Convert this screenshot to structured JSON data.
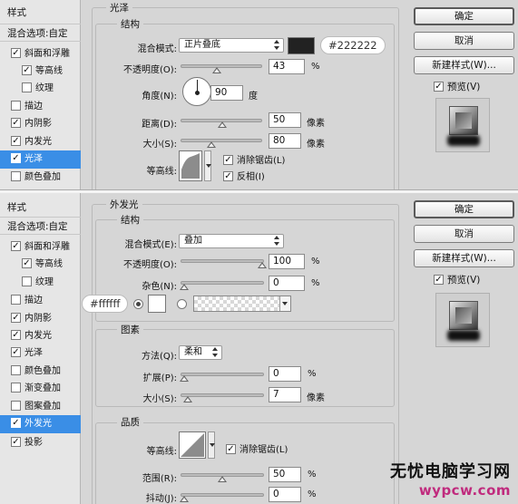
{
  "top": {
    "sidebar": {
      "header": "样式",
      "blend_options": "混合选项:自定",
      "items": [
        {
          "label": "斜面和浮雕",
          "checked": true
        },
        {
          "label": "等高线",
          "checked": true
        },
        {
          "label": "纹理",
          "checked": false
        },
        {
          "label": "描边",
          "checked": false
        },
        {
          "label": "内阴影",
          "checked": true
        },
        {
          "label": "内发光",
          "checked": true
        },
        {
          "label": "光泽",
          "checked": true
        },
        {
          "label": "颜色叠加",
          "checked": false
        }
      ]
    },
    "section_title": "光泽",
    "group_title": "结构",
    "blend_mode": {
      "label": "混合模式:",
      "value": "正片叠底"
    },
    "color_hex": "#222222",
    "color_value": "#222222",
    "opacity": {
      "label": "不透明度(O):",
      "value": "43",
      "unit": "%"
    },
    "angle": {
      "label": "角度(N):",
      "value": "90",
      "unit": "度"
    },
    "distance": {
      "label": "距离(D):",
      "value": "50",
      "unit": "像素"
    },
    "size": {
      "label": "大小(S):",
      "value": "80",
      "unit": "像素"
    },
    "contour": {
      "label": "等高线:"
    },
    "anti_alias": {
      "label": "消除锯齿(L)",
      "checked": true
    },
    "invert": {
      "label": "反相(I)",
      "checked": true
    },
    "buttons": {
      "ok": "确定",
      "cancel": "取消",
      "new_style": "新建样式(W)..."
    },
    "preview": {
      "label": "预览(V)",
      "checked": true
    }
  },
  "bottom": {
    "sidebar": {
      "header": "样式",
      "blend_options": "混合选项:自定",
      "items": [
        {
          "label": "斜面和浮雕",
          "checked": true
        },
        {
          "label": "等高线",
          "checked": true
        },
        {
          "label": "纹理",
          "checked": false
        },
        {
          "label": "描边",
          "checked": false
        },
        {
          "label": "内阴影",
          "checked": true
        },
        {
          "label": "内发光",
          "checked": true
        },
        {
          "label": "光泽",
          "checked": true
        },
        {
          "label": "颜色叠加",
          "checked": false
        },
        {
          "label": "渐变叠加",
          "checked": false
        },
        {
          "label": "图案叠加",
          "checked": false
        },
        {
          "label": "外发光",
          "checked": true
        },
        {
          "label": "投影",
          "checked": true
        }
      ]
    },
    "section_title": "外发光",
    "group_structure": "结构",
    "blend_mode": {
      "label": "混合模式(E):",
      "value": "叠加"
    },
    "opacity": {
      "label": "不透明度(O):",
      "value": "100",
      "unit": "%"
    },
    "noise": {
      "label": "杂色(N):",
      "value": "0",
      "unit": "%"
    },
    "color_hex": "#ffffff",
    "group_elements": "图素",
    "technique": {
      "label": "方法(Q):",
      "value": "柔和"
    },
    "spread": {
      "label": "扩展(P):",
      "value": "0",
      "unit": "%"
    },
    "size": {
      "label": "大小(S):",
      "value": "7",
      "unit": "像素"
    },
    "group_quality": "品质",
    "contour": {
      "label": "等高线:"
    },
    "anti_alias": {
      "label": "消除锯齿(L)",
      "checked": true
    },
    "range": {
      "label": "范围(R):",
      "value": "50",
      "unit": "%"
    },
    "jitter": {
      "label": "抖动(J):",
      "value": "0",
      "unit": "%"
    },
    "buttons": {
      "ok": "确定",
      "cancel": "取消",
      "new_style": "新建样式(W)..."
    },
    "preview": {
      "label": "预览(V)",
      "checked": true
    }
  },
  "watermark": {
    "line1": "无忧电脑学习网",
    "line2": "wypcw.com"
  },
  "colors": {
    "accent": "#3a8ee6",
    "swatch_dark": "#222222",
    "swatch_light": "#ffffff"
  }
}
